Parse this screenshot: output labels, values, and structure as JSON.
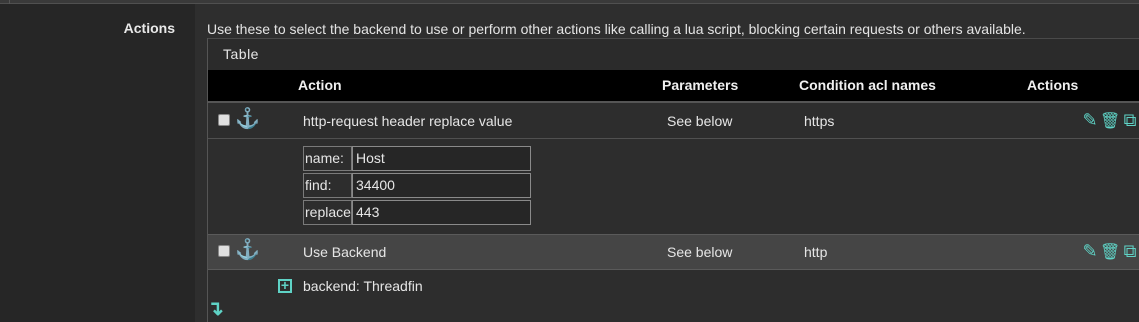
{
  "section": {
    "label": "Actions",
    "description": "Use these to select the backend to use or perform other actions like calling a lua script, blocking certain requests or others available."
  },
  "panel": {
    "title": "Table"
  },
  "table": {
    "headers": {
      "action": "Action",
      "parameters": "Parameters",
      "condition": "Condition acl names",
      "actions": "Actions"
    },
    "rows": [
      {
        "action": "http-request header replace value",
        "parameters": "See below",
        "condition": "https",
        "details": [
          {
            "label": "name:",
            "value": "Host"
          },
          {
            "label": "find:",
            "value": "34400"
          },
          {
            "label": "replace:",
            "value": "443"
          }
        ]
      },
      {
        "action": "Use Backend",
        "parameters": "See below",
        "condition": "http",
        "details_text": "backend: Threadfin"
      }
    ]
  },
  "icons": {
    "anchor": "⚓",
    "edit": "✎",
    "delete": "🗑",
    "copy": "⧉",
    "expand": "+",
    "down_arrow": "↴"
  },
  "colors": {
    "accent": "#5fd3c6",
    "background": "#262626",
    "header_bg": "#000000",
    "highlight_row": "#454545"
  }
}
